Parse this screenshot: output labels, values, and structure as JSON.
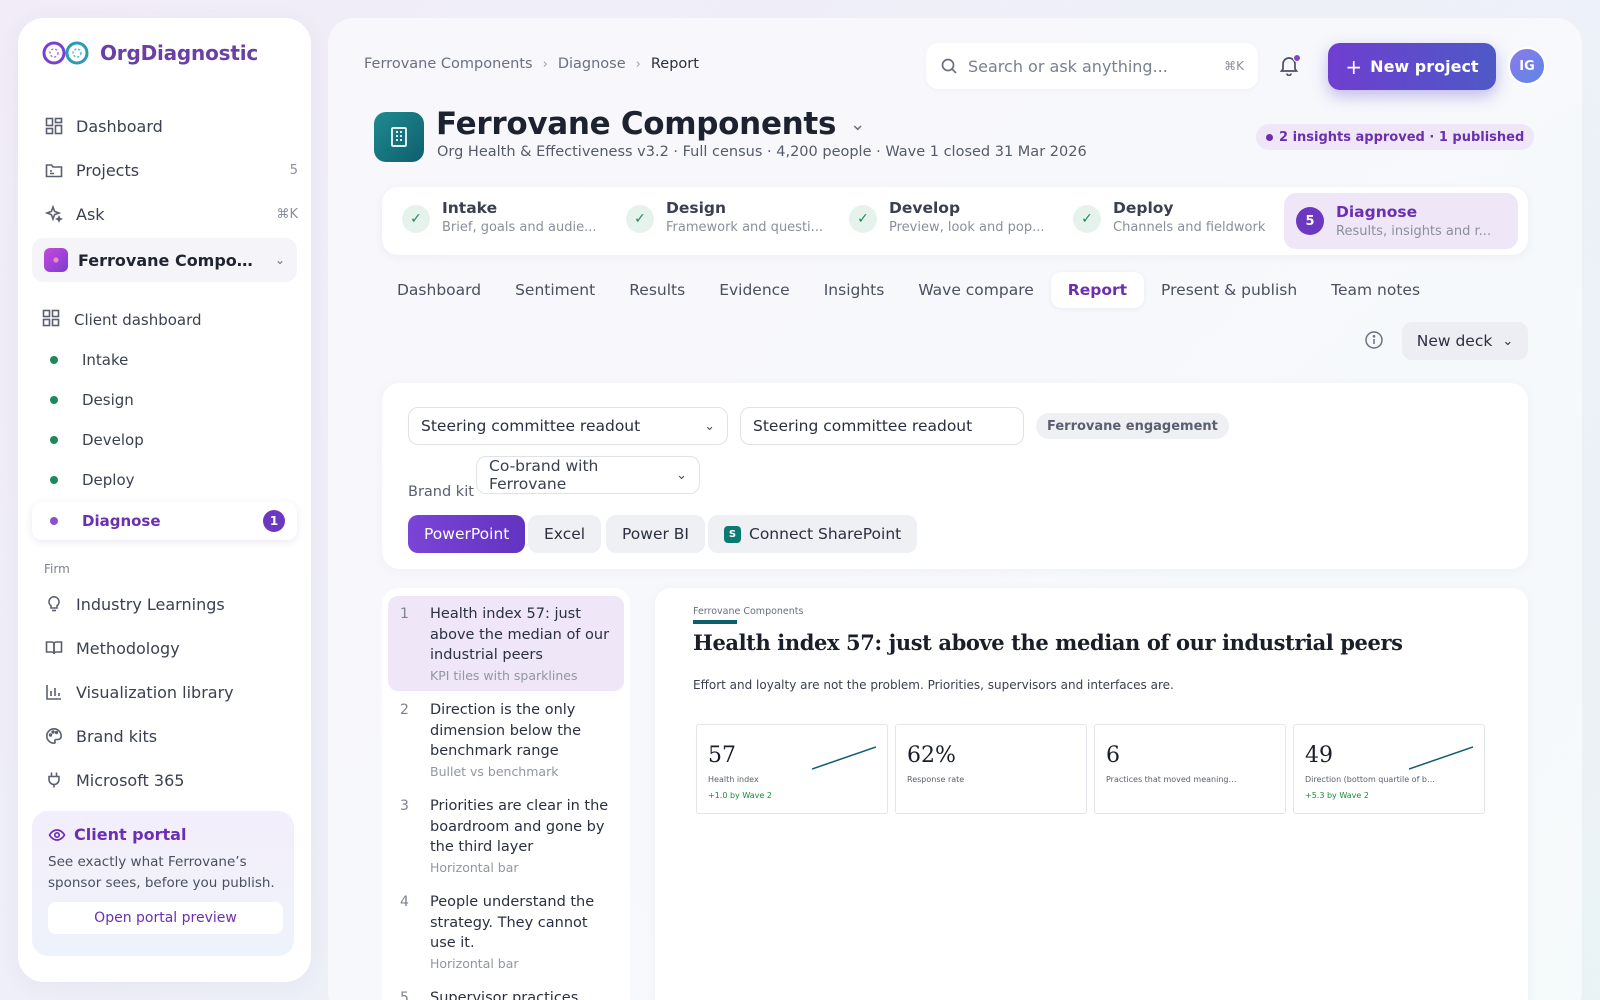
{
  "colors": {
    "accent": "#6b2fb0",
    "success": "#1b8a5a",
    "teal": "#0e5f6e"
  },
  "sidebar": {
    "logo_text": "OrgDiagnostic",
    "nav": [
      {
        "label": "Dashboard",
        "icon": "grid-icon",
        "meta": ""
      },
      {
        "label": "Projects",
        "icon": "folder-icon",
        "meta": "5"
      },
      {
        "label": "Ask",
        "icon": "sparkle-icon",
        "meta": "⌘K"
      }
    ],
    "project": {
      "name": "Ferrovane Compone..."
    },
    "project_items": [
      {
        "label": "Client dashboard"
      },
      {
        "label": "Intake"
      },
      {
        "label": "Design"
      },
      {
        "label": "Develop"
      },
      {
        "label": "Deploy"
      },
      {
        "label": "Diagnose",
        "badge": "1"
      }
    ],
    "firm_label": "Firm",
    "firm_items": [
      {
        "label": "Industry Learnings",
        "icon": "lightbulb-icon"
      },
      {
        "label": "Methodology",
        "icon": "book-icon"
      },
      {
        "label": "Visualization library",
        "icon": "bar-chart-icon"
      },
      {
        "label": "Brand kits",
        "icon": "palette-icon"
      },
      {
        "label": "Microsoft 365",
        "icon": "plug-icon"
      }
    ],
    "portal": {
      "title": "Client portal",
      "desc": "See exactly what Ferrovane’s sponsor sees, before you publish.",
      "button": "Open portal preview"
    }
  },
  "header": {
    "breadcrumb": [
      "Ferrovane Components",
      "Diagnose",
      "Report"
    ],
    "search_placeholder": "Search or ask anything...",
    "search_kbd": "⌘K",
    "new_project": "New project",
    "avatar": "IG"
  },
  "org": {
    "title": "Ferrovane Components",
    "subtitle": "Org Health & Effectiveness v3.2 · Full census · 4,200 people · Wave 1 closed 31 Mar 2026",
    "status": "2 insights approved · 1 published"
  },
  "steps": [
    {
      "label": "Intake",
      "desc": "Brief, goals and audie...",
      "state": "done"
    },
    {
      "label": "Design",
      "desc": "Framework and questi...",
      "state": "done"
    },
    {
      "label": "Develop",
      "desc": "Preview, look and pop...",
      "state": "done"
    },
    {
      "label": "Deploy",
      "desc": "Channels and fieldwork",
      "state": "done"
    },
    {
      "label": "Diagnose",
      "desc": "Results, insights and r...",
      "state": "active",
      "num": "5"
    }
  ],
  "tabs": [
    "Dashboard",
    "Sentiment",
    "Results",
    "Evidence",
    "Insights",
    "Wave compare",
    "Report",
    "Present & publish",
    "Team notes"
  ],
  "active_tab": "Report",
  "toolbar": {
    "new_deck": "New deck"
  },
  "config": {
    "template": "Steering committee readout",
    "deck_name": "Steering committee readout",
    "engagement_chip": "Ferrovane engagement",
    "brand_kit_label": "Brand kit",
    "brand_kit": "Co-brand with Ferrovane",
    "formats": [
      "PowerPoint",
      "Excel",
      "Power BI"
    ],
    "active_format": "PowerPoint",
    "sharepoint": "Connect SharePoint",
    "sharepoint_icon_letter": "S"
  },
  "outline": [
    {
      "n": "1",
      "title": "Health index 57: just above the median of our industrial peers",
      "kind": "KPI tiles with sparklines"
    },
    {
      "n": "2",
      "title": "Direction is the only dimension below the benchmark range",
      "kind": "Bullet vs benchmark"
    },
    {
      "n": "3",
      "title": "Priorities are clear in the boardroom and gone by the third layer",
      "kind": "Horizontal bar"
    },
    {
      "n": "4",
      "title": "People understand the strategy. They cannot use it.",
      "kind": "Horizontal bar"
    },
    {
      "n": "5",
      "title": "Supervisor practices",
      "kind": ""
    }
  ],
  "slide": {
    "brand": "Ferrovane Components",
    "title": "Health index 57: just above the median of our industrial peers",
    "subtitle": "Effort and loyalty are not the problem. Priorities, supervisors and interfaces are.",
    "kpis": [
      {
        "value": "57",
        "label": "Health index",
        "delta": "+1.0 by Wave 2",
        "spark": true
      },
      {
        "value": "62%",
        "label": "Response rate",
        "delta": "",
        "spark": false
      },
      {
        "value": "6",
        "label": "Practices that moved meaningfully",
        "delta": "",
        "spark": false
      },
      {
        "value": "49",
        "label": "Direction (bottom quartile of boo...",
        "delta": "+5.3 by Wave 2",
        "spark": true
      }
    ]
  }
}
